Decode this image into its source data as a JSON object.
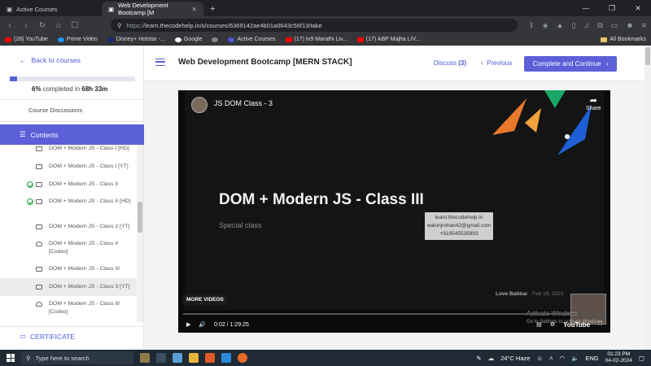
{
  "browser": {
    "tabs": [
      {
        "label": "Active Courses",
        "active": false
      },
      {
        "label": "Web Development Bootcamp [M",
        "active": true
      }
    ],
    "url_prefix": "https://",
    "url": "learn.thecodehelp.in/s/courses/6369142ae4b01a0643c56f13/take",
    "bookmarks": [
      {
        "label": "(28) YouTube",
        "color": "#ff0000"
      },
      {
        "label": "Prime Video",
        "color": "#1a98ff"
      },
      {
        "label": "Disney+ Hotstar -...",
        "color": "#1b2a6b"
      },
      {
        "label": "Google",
        "color": "#ffffff"
      },
      {
        "label": "",
        "color": "#888888"
      },
      {
        "label": "Active Courses",
        "color": "#4e5bd6"
      },
      {
        "label": "(17) tv9 Marathi Liv...",
        "color": "#ff0000"
      },
      {
        "label": "(17) ABP Majha LIV...",
        "color": "#ff0000"
      }
    ],
    "all_bookmarks": "All Bookmarks"
  },
  "sidebar": {
    "back_label": "Back to courses",
    "progress": {
      "percent": 6,
      "percent_text": "6%",
      "rest_text": "completed in",
      "time": "68h 33m"
    },
    "discussions_label": "Course Discussions",
    "contents_label": "Contents",
    "lessons": [
      {
        "title": "DOM + Modern JS - Class I [HD]",
        "checked": false,
        "icon": "video",
        "active": false
      },
      {
        "title": "DOM + Modern JS - Class I [YT]",
        "checked": false,
        "icon": "video",
        "active": false
      },
      {
        "title": "DOM + Modern JS - Class II",
        "checked": true,
        "icon": "video",
        "active": false
      },
      {
        "title": "DOM + Modern JS - Class II [HD]",
        "checked": true,
        "icon": "video",
        "active": false
      },
      {
        "title": "DOM + Modern JS - Class 2 [YT]",
        "checked": false,
        "icon": "video",
        "active": false
      },
      {
        "title": "DOM + Modern JS - Class II [Codes]",
        "checked": false,
        "icon": "cloud",
        "active": false
      },
      {
        "title": "DOM + Modern JS - Class III",
        "checked": false,
        "icon": "video",
        "active": false
      },
      {
        "title": "DOM + Modern JS - Class 3 [YT]",
        "checked": false,
        "icon": "video",
        "active": true
      },
      {
        "title": "DOM + Modern JS - Class III [Codes]",
        "checked": false,
        "icon": "cloud",
        "active": false
      },
      {
        "title": "DOM + Modern JS - Class IV",
        "checked": true,
        "icon": "video",
        "active": false
      }
    ],
    "certificate_label": "CERTIFICATE"
  },
  "header": {
    "course_title": "Web Development Bootcamp [MERN STACK]",
    "discuss_label": "Discuss",
    "discuss_count": "(3)",
    "previous_label": "Previous",
    "complete_label": "Complete and Continue"
  },
  "video": {
    "channel_title": "JS DOM Class - 3",
    "share_label": "Share",
    "slide_title": "DOM + Modern JS - Class III",
    "slide_subtitle": "Special class",
    "watermark_lines": [
      "learn.thecodehelp.in",
      "walunjrohan42@gmail.com",
      "+919545535893"
    ],
    "credit_name": "Love Babbar",
    "credit_date": "Feb 19, 2023",
    "more_videos": "MORE VIDEOS",
    "time_current": "0:02",
    "time_total": "1:29:25",
    "youtube_label": "YouTube",
    "activate_title": "Activate Windows",
    "activate_sub": "Go to Settings to activate Windows."
  },
  "taskbar": {
    "search_placeholder": "Type here to search",
    "weather": "24°C  Haze",
    "lang": "ENG",
    "time": "01:23 PM",
    "date": "04-02-2024"
  }
}
